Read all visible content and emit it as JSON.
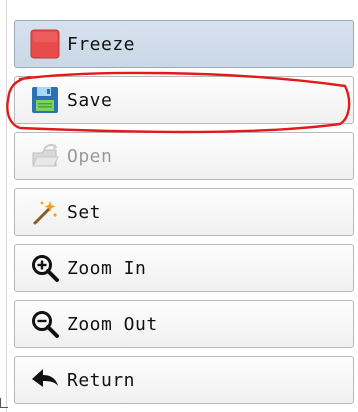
{
  "toolbar": {
    "buttons": [
      {
        "id": "freeze",
        "label": "Freeze",
        "icon": "freeze-square-icon",
        "state": "active",
        "color": "#e84b4b"
      },
      {
        "id": "save",
        "label": "Save",
        "icon": "floppy-disk-icon",
        "state": "normal"
      },
      {
        "id": "open",
        "label": "Open",
        "icon": "open-folder-icon",
        "state": "disabled"
      },
      {
        "id": "set",
        "label": "Set",
        "icon": "wand-icon",
        "state": "normal"
      },
      {
        "id": "zoom_in",
        "label": "Zoom In",
        "icon": "zoom-in-icon",
        "state": "normal"
      },
      {
        "id": "zoom_out",
        "label": "Zoom Out",
        "icon": "zoom-out-icon",
        "state": "normal"
      },
      {
        "id": "return",
        "label": "Return",
        "icon": "back-arrow-icon",
        "state": "normal"
      }
    ]
  },
  "annotation": {
    "target": "save",
    "color": "#e11b1b"
  }
}
